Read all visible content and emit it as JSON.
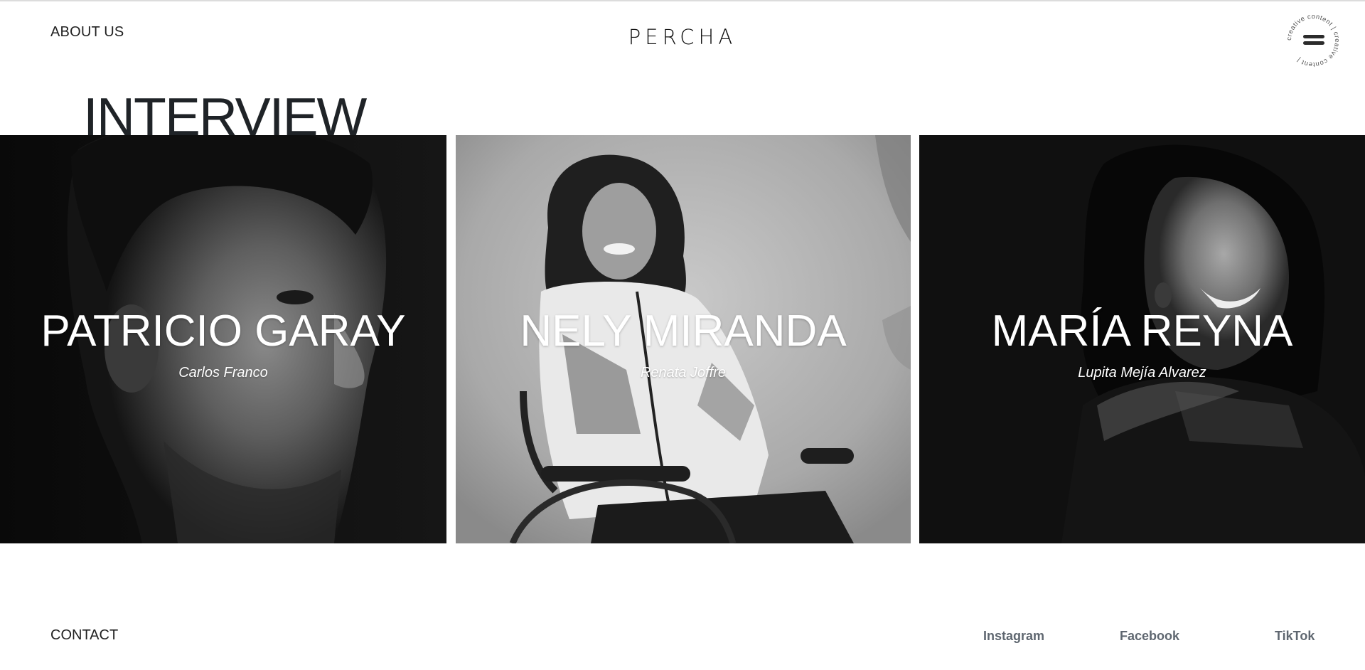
{
  "header": {
    "about_label": "ABOUT US",
    "logo_text": "PERCHA",
    "menu_badge_text": "creative content | creative content | "
  },
  "section": {
    "title": "INTERVIEW"
  },
  "interviews": [
    {
      "name": "PATRICIO GARAY",
      "author": "Carlos Franco"
    },
    {
      "name": "NELY MIRANDA",
      "author": "Renata Joffre"
    },
    {
      "name": "MARÍA REYNA",
      "author": "Lupita Mejía Alvarez"
    }
  ],
  "footer": {
    "contact_label": "CONTACT",
    "social": [
      {
        "label": "Instagram",
        "icon": "instagram"
      },
      {
        "label": "Facebook",
        "icon": "facebook"
      },
      {
        "label": "TikTok",
        "icon": "tiktok"
      }
    ]
  },
  "colors": {
    "text": "#222222",
    "title": "#1f2327",
    "social": "#5f6770",
    "card_dark": "#0d0d0d",
    "card_light": "#b5b5b5"
  }
}
